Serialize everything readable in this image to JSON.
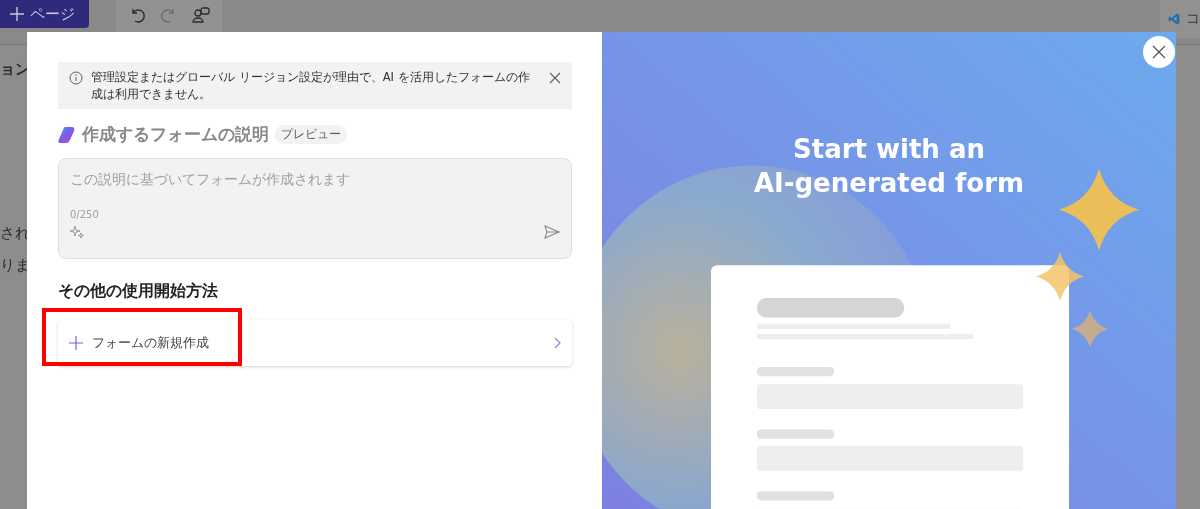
{
  "background": {
    "new_page_button": "ページ",
    "toolbar": [
      {
        "kind": "undo",
        "disabled": false
      },
      {
        "kind": "redo",
        "disabled": true
      },
      {
        "kind": "people",
        "disabled": false
      }
    ],
    "left_texts": [
      "ョン",
      "され",
      "りま"
    ],
    "right_texts": [
      "コ"
    ]
  },
  "dialog": {
    "notice": {
      "text": "管理設定またはグローバル リージョン設定が理由で、AI を活用したフォームの作成は利用できません。"
    },
    "description": {
      "heading": "作成するフォームの説明",
      "badge": "プレビュー",
      "placeholder": "この説明に基づいてフォームが作成されます",
      "counter": "0/250",
      "disabled": true
    },
    "other_methods": {
      "heading": "その他の使用開始方法",
      "options": [
        {
          "label": "フォームの新規作成",
          "highlighted": true
        }
      ]
    },
    "promo": {
      "title_lines": [
        "Start with an",
        "AI-generated form"
      ]
    }
  }
}
